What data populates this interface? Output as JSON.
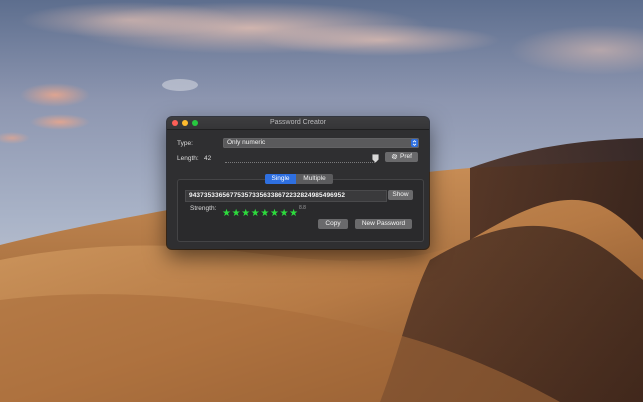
{
  "window": {
    "title": "Password Creator"
  },
  "type": {
    "label": "Type:",
    "value": "Only numeric"
  },
  "length": {
    "label": "Length:",
    "value": "42",
    "slider_fraction": 0.97
  },
  "pref_button": {
    "label": "Pref",
    "icon": "gear-icon"
  },
  "mode_tabs": [
    {
      "label": "Single",
      "selected": true
    },
    {
      "label": "Multiple",
      "selected": false
    }
  ],
  "password": {
    "value": "943735336567753573356338672232824985496952"
  },
  "show_button": {
    "label": "Show"
  },
  "strength": {
    "label": "Strength:",
    "stars_filled": 8,
    "stars_total": 8,
    "value": "8.8"
  },
  "actions": {
    "copy_label": "Copy",
    "new_password_label": "New Password"
  },
  "colors": {
    "accent": "#2e6fe0",
    "star": "#2ddc3d",
    "window_bg": "#2f2f31"
  }
}
